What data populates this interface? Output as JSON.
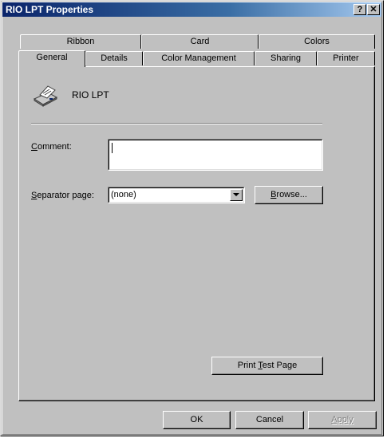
{
  "window": {
    "title": "RIO LPT Properties",
    "help_btn": "?",
    "close_btn": "✕"
  },
  "tabs_row1": [
    {
      "label": "Ribbon"
    },
    {
      "label": "Card"
    },
    {
      "label": "Colors"
    }
  ],
  "tabs_row2": [
    {
      "label": "General"
    },
    {
      "label": "Details"
    },
    {
      "label": "Color Management"
    },
    {
      "label": "Sharing"
    },
    {
      "label": "Printer"
    }
  ],
  "general": {
    "printer_name": "RIO LPT",
    "comment": {
      "key": "C",
      "rest": "omment:",
      "value": ""
    },
    "separator": {
      "key": "S",
      "rest": "eparator page:",
      "value": "(none)"
    },
    "browse": {
      "key": "B",
      "rest": "rowse..."
    },
    "print_test": {
      "pre": "Print ",
      "key": "T",
      "rest": "est Page"
    }
  },
  "footer": {
    "ok": "OK",
    "cancel": "Cancel",
    "apply": "Apply"
  },
  "colors": {
    "title_start": "#0a246a",
    "title_end": "#a6caf0",
    "face": "#c0c0c0"
  }
}
